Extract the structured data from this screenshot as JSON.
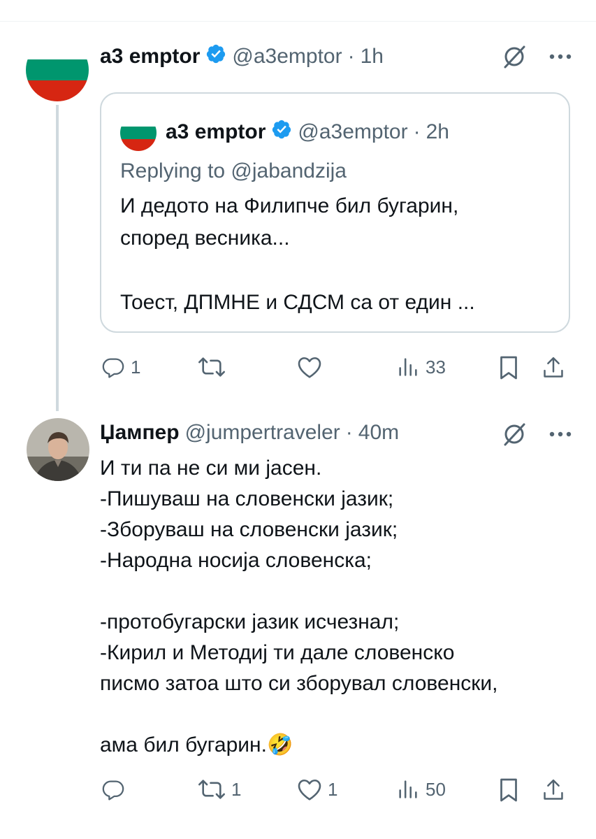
{
  "colors": {
    "text": "#0f1419",
    "secondary": "#536471",
    "verified": "#1d9bf0",
    "border": "#cfd9de",
    "flag_white": "#ffffff",
    "flag_green": "#00966e",
    "flag_red": "#d62612"
  },
  "tweet1": {
    "name": "а3 emptor",
    "handle": "@а3emptor",
    "separator": "·",
    "time": "1h",
    "verified": true,
    "avatar": "bulgarian-flag",
    "quote": {
      "name": "а3 emptor",
      "handle": "@а3emptor",
      "separator": "·",
      "time": "2h",
      "replying_to": "Replying to @jabandzija",
      "text": "И дедото на Филипче бил бугарин,\nспоред весника...\n\nТоест, ДПМНЕ и СДСМ са от един ..."
    },
    "actions": {
      "replies": "1",
      "reposts": "",
      "likes": "",
      "views": "33"
    }
  },
  "tweet2": {
    "name": "Џампер",
    "handle": "@jumpertraveler",
    "separator": "·",
    "time": "40m",
    "avatar": "user-photo",
    "text": "И ти па не си ми јасен.\n-Пишуваш на словенски јазик;\n-Зборуваш на словенски јазик;\n-Народна носија словенска;\n\n-протобугарски јазик исчезнал;\n-Кирил и Методиј ти дале словенско\nписмо затоа што си зборувал словенски,\n\nама бил бугарин.",
    "emoji": "🤣",
    "actions": {
      "replies": "",
      "reposts": "1",
      "likes": "1",
      "views": "50"
    }
  },
  "icons": [
    "grok-icon",
    "more-icon",
    "reply-icon",
    "repost-icon",
    "like-icon",
    "views-icon",
    "bookmark-icon",
    "share-icon",
    "verified-icon"
  ]
}
